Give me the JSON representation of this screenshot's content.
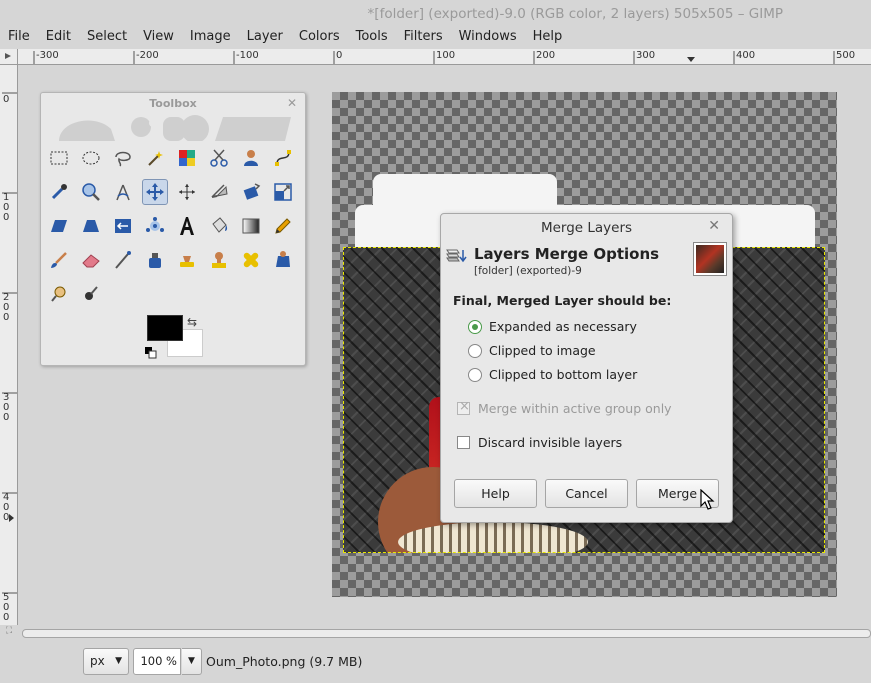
{
  "window": {
    "title": "*[folder] (exported)-9.0 (RGB color, 2 layers) 505x505 – GIMP"
  },
  "menu": [
    "File",
    "Edit",
    "Select",
    "View",
    "Image",
    "Layer",
    "Colors",
    "Tools",
    "Filters",
    "Windows",
    "Help"
  ],
  "ruler": {
    "h_labels": [
      "-300",
      "-200",
      "-100",
      "0",
      "100",
      "200",
      "300",
      "400",
      "500"
    ],
    "v_labels": [
      "0",
      "100",
      "200",
      "300",
      "400",
      "500"
    ]
  },
  "toolbox": {
    "title": "Toolbox",
    "tools": [
      "rect-select",
      "ellipse-select",
      "free-select",
      "fuzzy-select",
      "select-by-color",
      "scissors-select",
      "foreground-select",
      "paths",
      "color-picker",
      "zoom",
      "measure",
      "move",
      "align",
      "crop",
      "unified-transform",
      "scale",
      "shear",
      "perspective",
      "flip",
      "cage-transform",
      "text",
      "bucket-fill",
      "blend",
      "pencil",
      "paintbrush",
      "eraser",
      "airbrush",
      "ink",
      "mypaint-brush",
      "clone",
      "heal",
      "smudge",
      "dodge-burn",
      "blur-sharpen"
    ],
    "active_tool": "move",
    "foreground_color": "#000000",
    "background_color": "#ffffff"
  },
  "dialog": {
    "title": "Merge Layers",
    "heading": "Layers Merge Options",
    "subtitle": "[folder] (exported)-9",
    "section_label": "Final, Merged Layer should be:",
    "options": [
      {
        "label": "Expanded as necessary",
        "selected": true
      },
      {
        "label": "Clipped to image",
        "selected": false
      },
      {
        "label": "Clipped to bottom layer",
        "selected": false
      }
    ],
    "merge_within_group": {
      "label": "Merge within active group only",
      "checked": true,
      "enabled": false
    },
    "discard_invisible": {
      "label": "Discard invisible layers",
      "checked": false,
      "enabled": true
    },
    "buttons": {
      "help": "Help",
      "cancel": "Cancel",
      "merge": "Merge"
    }
  },
  "statusbar": {
    "unit": "px",
    "zoom": "100 %",
    "info": "Oum_Photo.png (9.7 MB)"
  },
  "colors": {
    "accent_green": "#4a9a4a",
    "selection_marching": "#e8e800"
  }
}
